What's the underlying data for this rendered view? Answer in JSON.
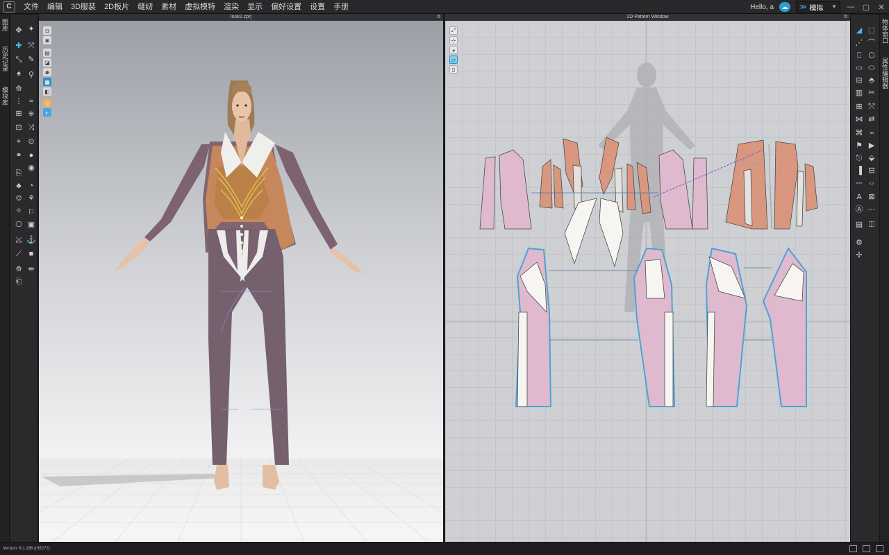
{
  "menubar": {
    "logo": "C",
    "items": [
      "文件",
      "编辑",
      "3D服装",
      "2D板片",
      "缝纫",
      "素材",
      "虚拟模特",
      "渲染",
      "显示",
      "偏好设置",
      "设置",
      "手册"
    ],
    "hello": "Hello, a",
    "mode": "模拟"
  },
  "left_strip": {
    "tabs": [
      "图库",
      "历史记录",
      "模块库"
    ]
  },
  "right_strip": {
    "tabs": [
      "物体窗口",
      "属性编辑器"
    ]
  },
  "pane3d": {
    "title": "look2.zprj"
  },
  "pane2d": {
    "title": "2D Pattern Window"
  },
  "status": {
    "version": "Version: 6.1.186 (r35272)"
  },
  "colors": {
    "accent": "#49b6ef",
    "jacket": "#7d6272",
    "collar": "#efefec",
    "pants": "#75606d",
    "pattern_pink": "#dfb9cd",
    "pattern_orange": "#d9977f",
    "pattern_white": "#f6f5f2"
  },
  "icons": {
    "cloud": "cloud-icon",
    "mode": "simulation-icon",
    "tools": [
      "select-icon",
      "move-icon",
      "transform-icon",
      "sewing-icon",
      "pin-icon",
      "steam-icon",
      "fold-icon",
      "measure-icon",
      "button-icon",
      "zipper-icon",
      "text-icon",
      "trim-icon"
    ]
  }
}
